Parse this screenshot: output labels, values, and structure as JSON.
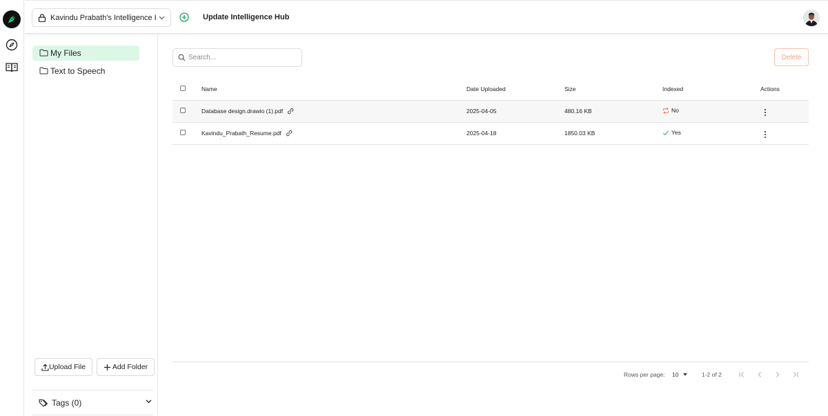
{
  "header": {
    "hub_name": "Kavindu Prabath's Intelligence Hub",
    "update_label": "Update Intelligence Hub"
  },
  "folders": {
    "items": [
      {
        "label": "My Files",
        "active": true
      },
      {
        "label": "Text to Speech",
        "active": false
      }
    ],
    "upload_label": "Upload File",
    "add_folder_label": "Add Folder",
    "tags_label": "Tags (0)"
  },
  "search": {
    "placeholder": "Search..."
  },
  "toolbar": {
    "delete_label": "Delete"
  },
  "table": {
    "columns": {
      "name": "Name",
      "date": "Date Uploaded",
      "size": "Size",
      "indexed": "Indexed",
      "actions": "Actions"
    },
    "rows": [
      {
        "name": "Database design.drawio (1).pdf",
        "date": "2025-04-05",
        "size": "480.16 KB",
        "indexed": "No",
        "indexed_icon": "refresh-icon"
      },
      {
        "name": "Kavindu_Prabath_Resume.pdf",
        "date": "2025-04-18",
        "size": "1850.03 KB",
        "indexed": "Yes",
        "indexed_icon": "check-icon"
      }
    ]
  },
  "pagination": {
    "rows_per_page_label": "Rows per page:",
    "rows_per_page_value": "10",
    "range": "1-2 of 2"
  },
  "colors": {
    "accent_green": "#1aa36b",
    "active_folder_bg": "#dcf7e6",
    "not_indexed": "#e8663d",
    "indexed": "#1aa36b",
    "delete_disabled": "#f0a58b"
  }
}
